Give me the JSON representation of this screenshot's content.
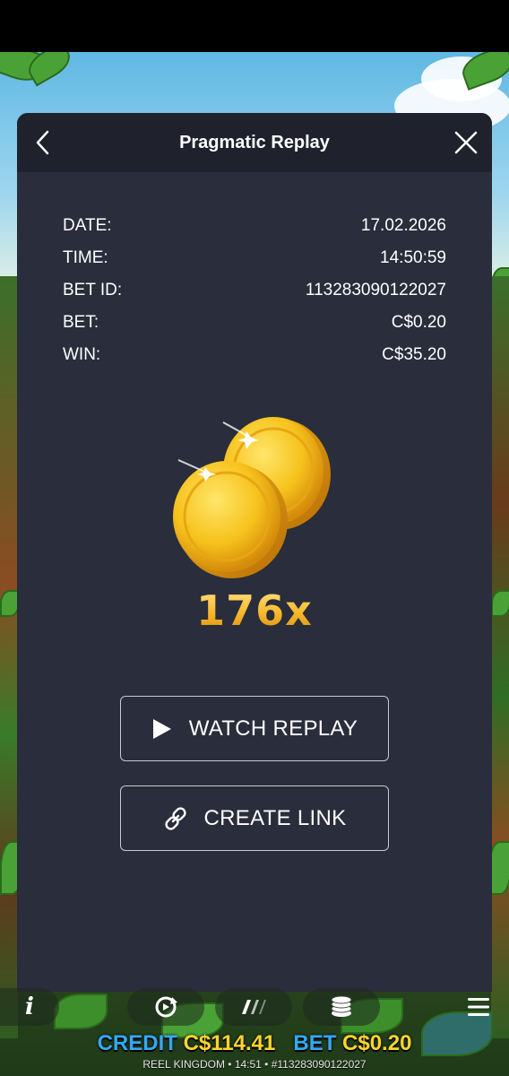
{
  "modal": {
    "title": "Pragmatic Replay",
    "details": [
      {
        "label": "DATE:",
        "value": "17.02.2026"
      },
      {
        "label": "TIME:",
        "value": "14:50:59"
      },
      {
        "label": "BET ID:",
        "value": "113283090122027"
      },
      {
        "label": "BET:",
        "value": "C$0.20"
      },
      {
        "label": "WIN:",
        "value": "C$35.20"
      }
    ],
    "multiplier": "176x",
    "watch_replay_label": "WATCH REPLAY",
    "create_link_label": "CREATE LINK"
  },
  "toolbar": {
    "info_label": "i"
  },
  "footer": {
    "credit_label": "CREDIT",
    "credit_value": "C$114.41",
    "bet_label": "BET",
    "bet_value": "C$0.20",
    "info_line": "REEL KINGDOM • 14:51 • #113283090122027"
  },
  "colors": {
    "modal_bg": "#2a2d3b",
    "header_bg": "#1f212c",
    "multiplier_gold": "#f7b72a",
    "credit_blue": "#35a8f5",
    "credit_yellow": "#ffd52c"
  },
  "icons": [
    "back-icon",
    "close-icon",
    "play-icon",
    "link-icon",
    "info-icon",
    "autoplay-icon",
    "turbo-icon",
    "bet-coins-icon",
    "menu-icon",
    "coins-icon"
  ]
}
